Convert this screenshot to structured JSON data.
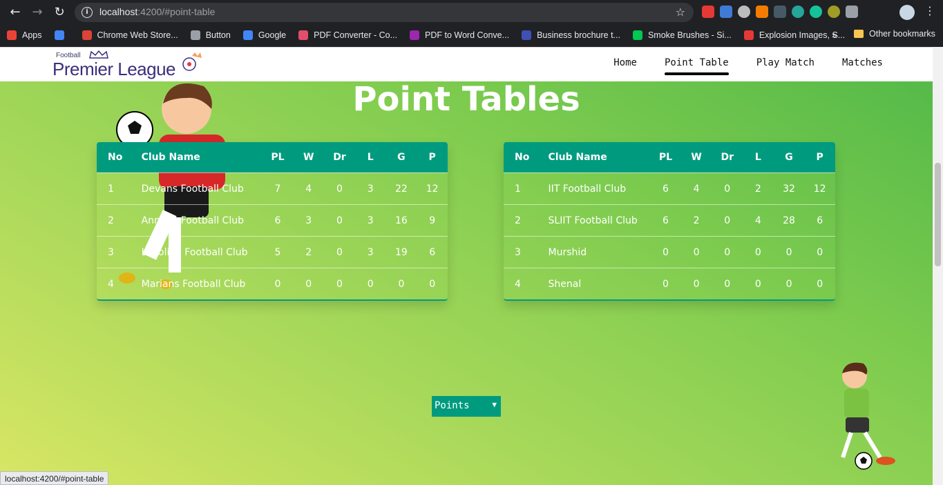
{
  "browser": {
    "url_host": "localhost",
    "url_rest": ":4200/#point-table",
    "bookmarks": [
      {
        "label": "Apps",
        "color": "#ea4335"
      },
      {
        "label": "",
        "color": "#4285f4"
      },
      {
        "label": "Chrome Web Store...",
        "color": "#db4437"
      },
      {
        "label": "Button",
        "color": "#9aa0a6"
      },
      {
        "label": "Google",
        "color": "#4285f4"
      },
      {
        "label": "PDF Converter - Co...",
        "color": "#e44d6b"
      },
      {
        "label": "PDF to Word Conve...",
        "color": "#9c27b0"
      },
      {
        "label": "Business brochure t...",
        "color": "#3f51b5"
      },
      {
        "label": "Smoke Brushes - Si...",
        "color": "#00c853"
      },
      {
        "label": "Explosion Images, S...",
        "color": "#e53935"
      }
    ],
    "bookmarks_more": "»",
    "other_bookmarks": "Other bookmarks",
    "status_url": "localhost:4200/#point-table"
  },
  "nav": {
    "logo_small": "Football",
    "logo_big": "Premier League",
    "links": [
      "Home",
      "Point Table",
      "Play Match",
      "Matches"
    ],
    "active": "Point Table"
  },
  "heading": "Point Tables",
  "tables": [
    {
      "headers": [
        "No",
        "Club Name",
        "PL",
        "W",
        "Dr",
        "L",
        "G",
        "P"
      ],
      "rows": [
        [
          "1",
          "Devans Football Club",
          "7",
          "4",
          "0",
          "3",
          "22",
          "12"
        ],
        [
          "2",
          "Annites Football Club",
          "6",
          "3",
          "0",
          "3",
          "16",
          "9"
        ],
        [
          "3",
          "Loyolian Football Club",
          "5",
          "2",
          "0",
          "3",
          "19",
          "6"
        ],
        [
          "4",
          "Marians Football Club",
          "0",
          "0",
          "0",
          "0",
          "0",
          "0"
        ]
      ]
    },
    {
      "headers": [
        "No",
        "Club Name",
        "PL",
        "W",
        "Dr",
        "L",
        "G",
        "P"
      ],
      "rows": [
        [
          "1",
          "IIT Football Club",
          "6",
          "4",
          "0",
          "2",
          "32",
          "12"
        ],
        [
          "2",
          "SLIIT Football Club",
          "6",
          "2",
          "0",
          "4",
          "28",
          "6"
        ],
        [
          "3",
          "Murshid",
          "0",
          "0",
          "0",
          "0",
          "0",
          "0"
        ],
        [
          "4",
          "Shenal",
          "0",
          "0",
          "0",
          "0",
          "0",
          "0"
        ]
      ]
    }
  ],
  "sort_select": {
    "value": "Points",
    "icon": "chevron-down-icon"
  },
  "colors": {
    "accent": "#009b7f",
    "nav_bg": "#ffffff"
  }
}
